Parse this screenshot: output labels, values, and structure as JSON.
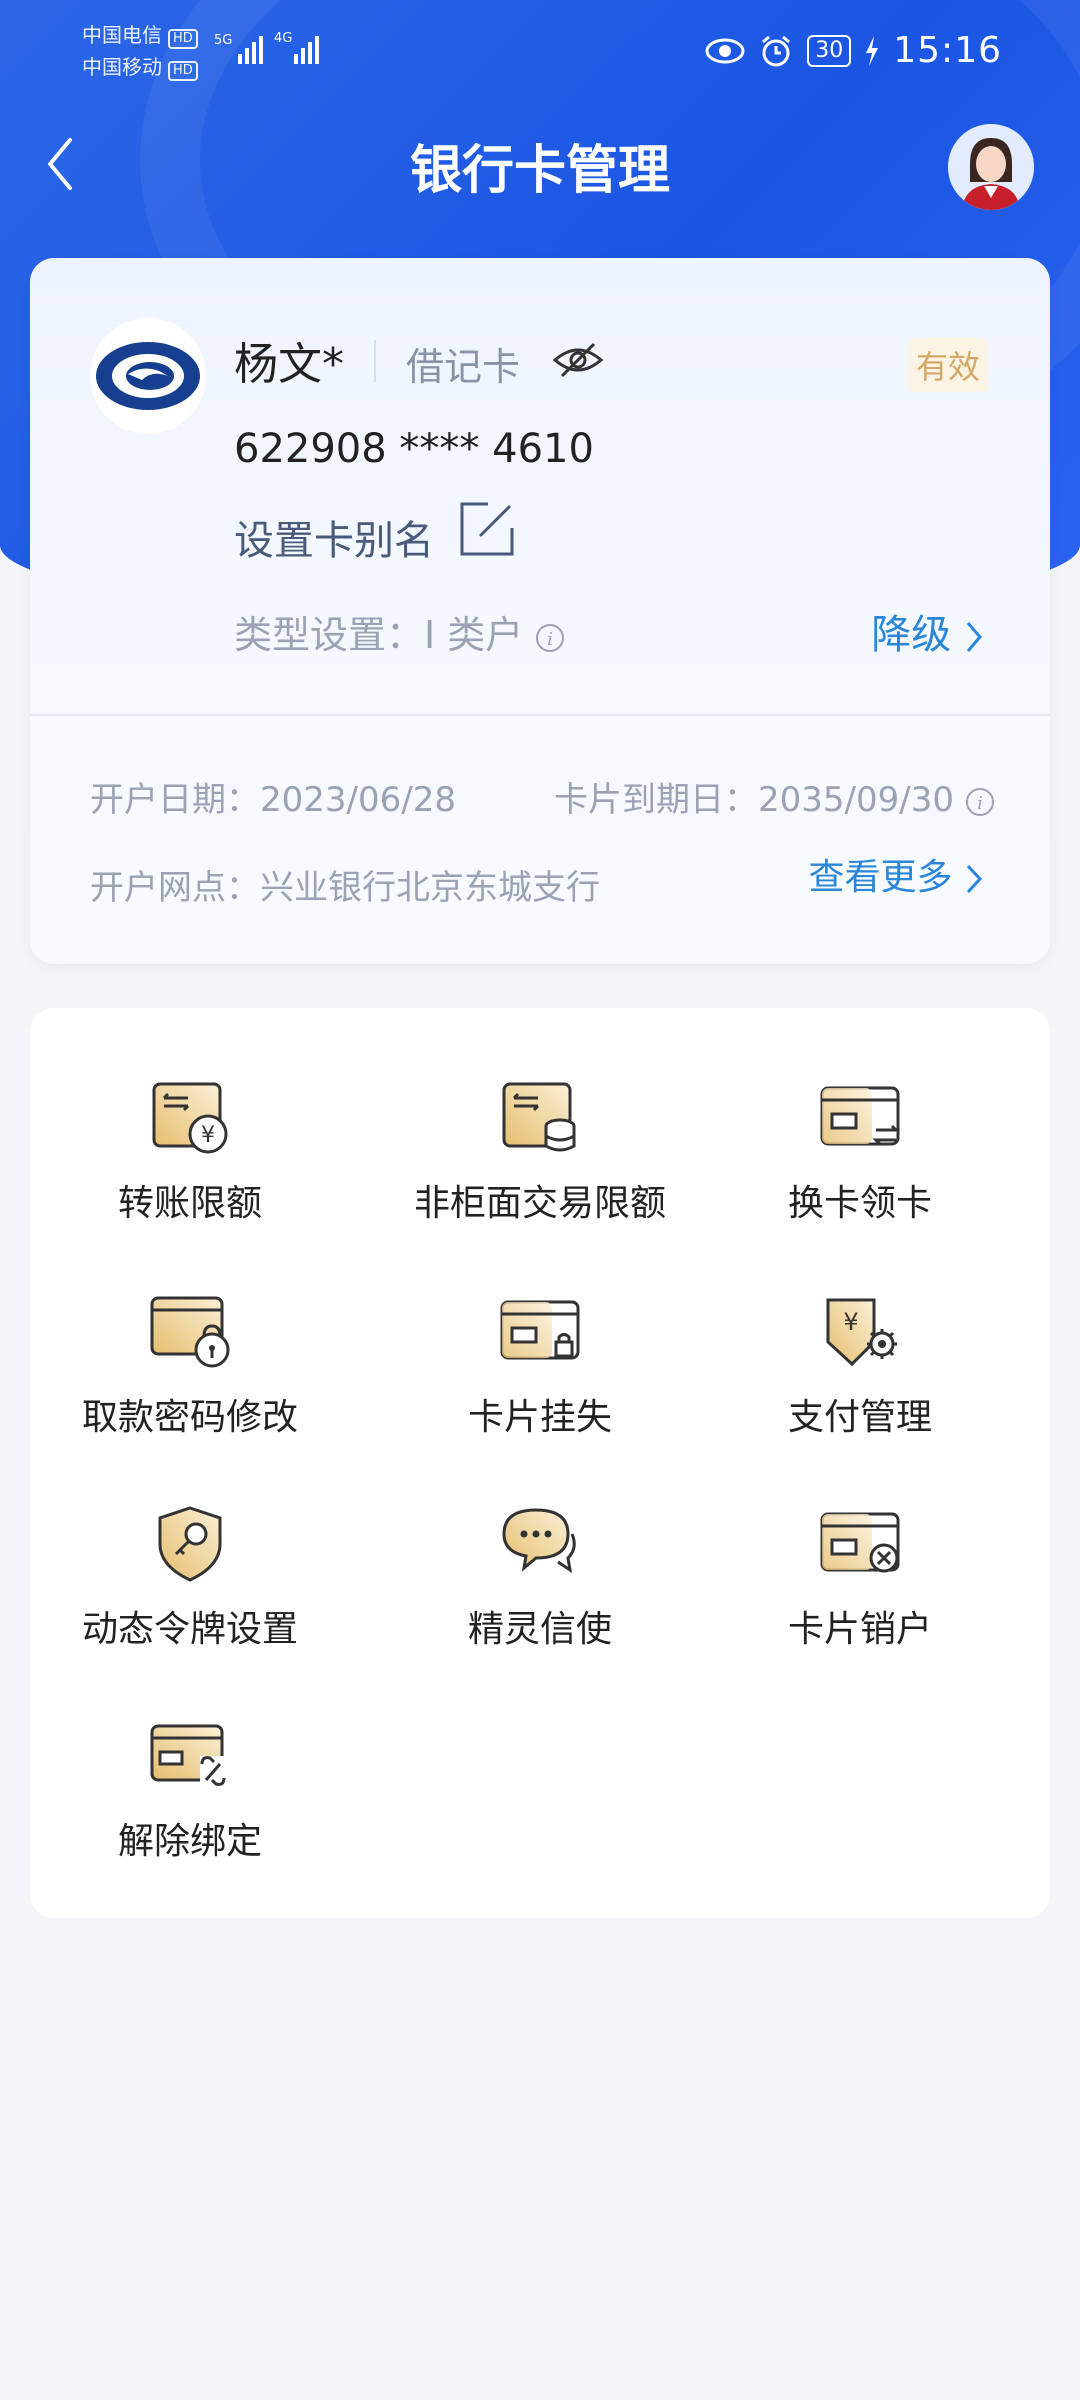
{
  "status": {
    "carrier1": "中国电信",
    "carrier2": "中国移动",
    "hd": "HD",
    "net1": "5G",
    "net2": "4G",
    "battery": "30",
    "time": "15:16"
  },
  "header": {
    "title": "银行卡管理"
  },
  "card": {
    "holder": "杨文*",
    "type": "借记卡",
    "status": "有效",
    "number": "622908 **** 4610",
    "alias_label": "设置卡别名",
    "type_setting": "类型设置：I 类户",
    "downgrade": "降级",
    "open_date": "开户日期：2023/06/28",
    "expire_date": "卡片到期日：2035/09/30",
    "branch": "开户网点：兴业银行北京东城支行",
    "more": "查看更多"
  },
  "colors": {
    "brand_blue": "#1b56e3",
    "gold": "#e8c57a",
    "link": "#2a86d8"
  },
  "services": [
    {
      "label": "转账限额",
      "icon": "transfer-limit-icon"
    },
    {
      "label": "非柜面交易限额",
      "icon": "non-counter-limit-icon"
    },
    {
      "label": "换卡领卡",
      "icon": "card-exchange-icon"
    },
    {
      "label": "取款密码修改",
      "icon": "password-lock-icon"
    },
    {
      "label": "卡片挂失",
      "icon": "card-lock-icon"
    },
    {
      "label": "支付管理",
      "icon": "payment-settings-icon"
    },
    {
      "label": "动态令牌设置",
      "icon": "shield-key-icon"
    },
    {
      "label": "精灵信使",
      "icon": "chat-bubble-icon"
    },
    {
      "label": "卡片销户",
      "icon": "card-cancel-icon"
    },
    {
      "label": "解除绑定",
      "icon": "unlink-card-icon"
    }
  ]
}
